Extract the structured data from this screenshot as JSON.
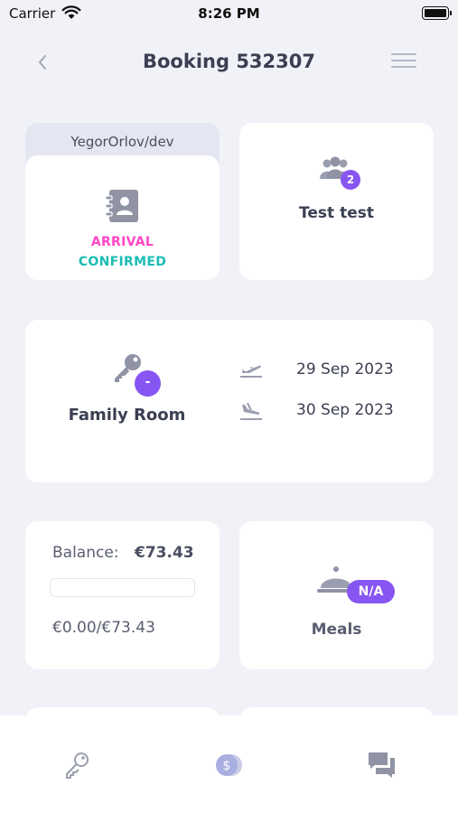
{
  "status_bar": {
    "carrier": "Carrier",
    "time": "8:26 PM",
    "icons": [
      "wifi-icon",
      "battery-icon"
    ]
  },
  "nav": {
    "title": "Booking 532307",
    "icons": [
      "chevron-left-icon",
      "hamburger-menu-icon"
    ]
  },
  "status_card": {
    "user": "YegorOrlov/dev",
    "arrival": "ARRIVAL",
    "confirmed": "CONFIRMED",
    "icon": "contact-book-icon"
  },
  "guests_card": {
    "count": "2",
    "name": "Test test",
    "icon": "group-icon"
  },
  "room_card": {
    "badge": "-",
    "room": "Family Room",
    "arrival_date": "29 Sep 2023",
    "departure_date": "30 Sep 2023",
    "icons": [
      "key-icon",
      "plane-takeoff-icon",
      "plane-landing-icon"
    ]
  },
  "balance_card": {
    "label": "Balance:",
    "amount": "€73.43",
    "paid": "€0.00/€73.43",
    "paid_fraction": 0
  },
  "meals_card": {
    "badge": "N/A",
    "label": "Meals",
    "icon": "cloche-icon"
  },
  "tab_bar": {
    "tabs": [
      "key-tab-icon",
      "coins-tab-icon",
      "chat-tab-icon"
    ]
  },
  "colors": {
    "accent": "#8755f2",
    "arrival": "#ff45c4",
    "confirmed": "#1bbdb4",
    "background": "#f1f2f7"
  }
}
